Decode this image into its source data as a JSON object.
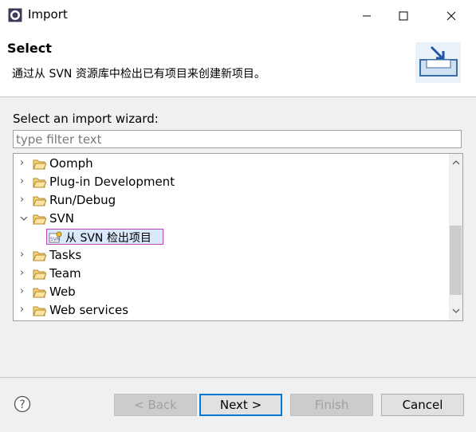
{
  "window": {
    "title": "Import",
    "minimize_icon": "minimize-icon",
    "maximize_icon": "maximize-icon",
    "close_icon": "close-icon"
  },
  "header": {
    "title": "Select",
    "description": "通过从 SVN 资源库中检出已有项目来创建新项目。"
  },
  "wizard": {
    "label": "Select an import wizard:",
    "filter_placeholder": "type filter text",
    "items": [
      {
        "label": "Oomph",
        "expanded": false
      },
      {
        "label": "Plug-in Development",
        "expanded": false
      },
      {
        "label": "Run/Debug",
        "expanded": false
      },
      {
        "label": "SVN",
        "expanded": true,
        "children": [
          {
            "label": "从 SVN 检出项目",
            "selected": true
          }
        ]
      },
      {
        "label": "Tasks",
        "expanded": false
      },
      {
        "label": "Team",
        "expanded": false
      },
      {
        "label": "Web",
        "expanded": false
      },
      {
        "label": "Web services",
        "expanded": false
      }
    ]
  },
  "buttons": {
    "back": "< Back",
    "next": "Next >",
    "finish": "Finish",
    "cancel": "Cancel"
  },
  "colors": {
    "accent": "#0078d7",
    "selection": "#d9e8fa",
    "selection_border": "#c040c0"
  }
}
